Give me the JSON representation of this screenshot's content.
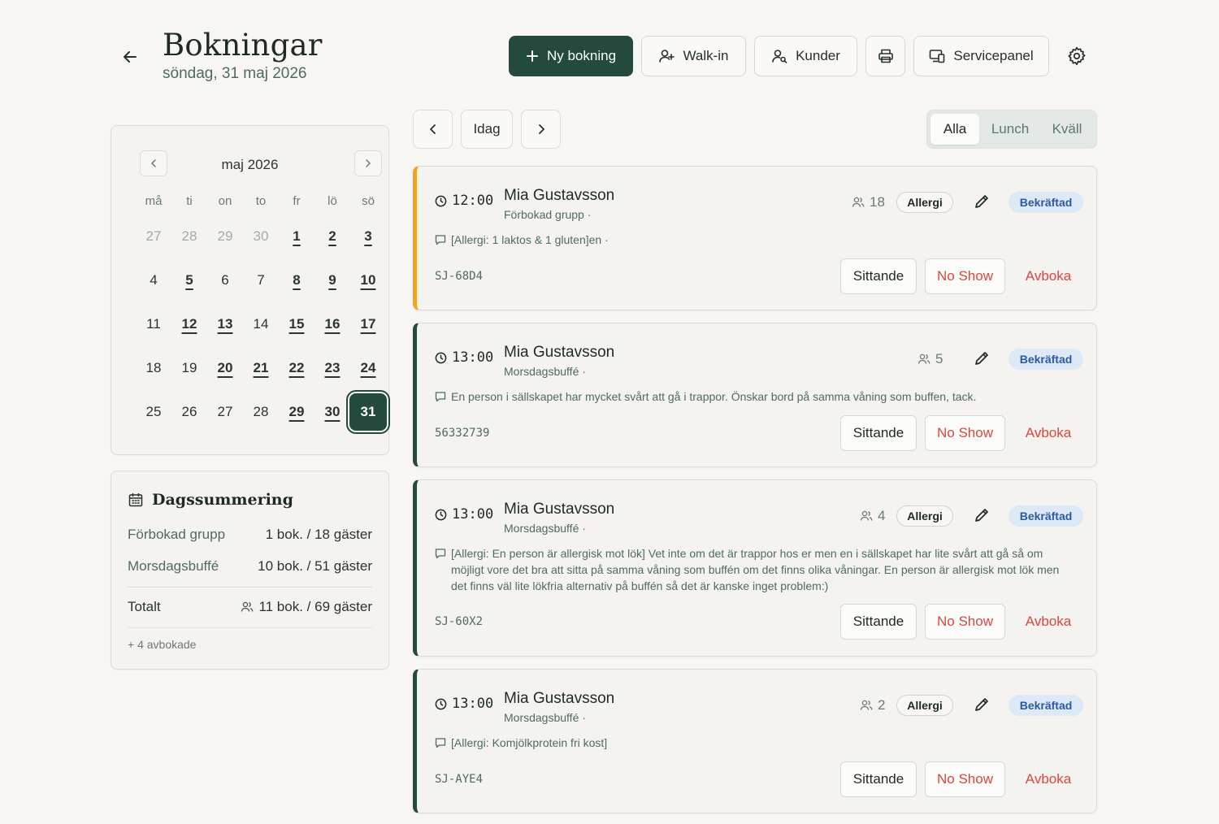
{
  "header": {
    "title": "Bokningar",
    "date": "söndag, 31 maj 2026",
    "buttons": {
      "new_booking": "Ny bokning",
      "walk_in": "Walk-in",
      "customers": "Kunder",
      "service_panel": "Servicepanel"
    }
  },
  "calendar": {
    "month": "maj 2026",
    "weekdays": [
      "må",
      "ti",
      "on",
      "to",
      "fr",
      "lö",
      "sö"
    ],
    "weeks": [
      [
        {
          "d": "27",
          "m": true
        },
        {
          "d": "28",
          "m": true
        },
        {
          "d": "29",
          "m": true
        },
        {
          "d": "30",
          "m": true
        },
        {
          "d": "1",
          "b": true
        },
        {
          "d": "2",
          "b": true
        },
        {
          "d": "3",
          "b": true
        }
      ],
      [
        {
          "d": "4"
        },
        {
          "d": "5",
          "b": true
        },
        {
          "d": "6"
        },
        {
          "d": "7"
        },
        {
          "d": "8",
          "b": true
        },
        {
          "d": "9",
          "b": true
        },
        {
          "d": "10",
          "b": true
        }
      ],
      [
        {
          "d": "11"
        },
        {
          "d": "12",
          "b": true
        },
        {
          "d": "13",
          "b": true
        },
        {
          "d": "14"
        },
        {
          "d": "15",
          "b": true
        },
        {
          "d": "16",
          "b": true
        },
        {
          "d": "17",
          "b": true
        }
      ],
      [
        {
          "d": "18"
        },
        {
          "d": "19"
        },
        {
          "d": "20",
          "b": true
        },
        {
          "d": "21",
          "b": true
        },
        {
          "d": "22",
          "b": true
        },
        {
          "d": "23",
          "b": true
        },
        {
          "d": "24",
          "b": true
        }
      ],
      [
        {
          "d": "25"
        },
        {
          "d": "26"
        },
        {
          "d": "27"
        },
        {
          "d": "28"
        },
        {
          "d": "29",
          "b": true
        },
        {
          "d": "30",
          "b": true
        },
        {
          "d": "31",
          "s": true
        }
      ]
    ]
  },
  "summary": {
    "title": "Dagssummering",
    "rows": [
      {
        "label": "Förbokad grupp",
        "value": "1 bok. / 18 gäster"
      },
      {
        "label": "Morsdagsbuffé",
        "value": "10 bok. / 51 gäster"
      }
    ],
    "total_label": "Totalt",
    "total_value": "11 bok. / 69 gäster",
    "cancelled": "+ 4 avbokade"
  },
  "date_nav": {
    "today": "Idag",
    "filters": [
      "Alla",
      "Lunch",
      "Kväll"
    ],
    "active_filter": "Alla"
  },
  "colors": {
    "primary": "#234a3c",
    "accent_orange": "#f0a422",
    "danger": "#d9473f",
    "status_bg": "#dde9f7",
    "status_text": "#2b5aa5"
  },
  "bookings": [
    {
      "time": "12:00",
      "name": "Mia Gustavsson",
      "type": "Förbokad grupp ·",
      "guests": "18",
      "allergy": "Allergi",
      "status": "Bekräftad",
      "note": "[Allergi: 1 laktos & 1 gluten]en ·",
      "code": "SJ-68D4",
      "sit": "Sittande",
      "noshow": "No Show",
      "cancel": "Avboka"
    },
    {
      "time": "13:00",
      "name": "Mia Gustavsson",
      "type": "Morsdagsbuffé ·",
      "guests": "5",
      "allergy": "",
      "status": "Bekräftad",
      "note": "En person i sällskapet har mycket svårt att gå i trappor. Önskar bord på samma våning som buffen, tack.",
      "code": "56332739",
      "sit": "Sittande",
      "noshow": "No Show",
      "cancel": "Avboka"
    },
    {
      "time": "13:00",
      "name": "Mia Gustavsson",
      "type": "Morsdagsbuffé ·",
      "guests": "4",
      "allergy": "Allergi",
      "status": "Bekräftad",
      "note": "[Allergi: En person är allergisk mot lök] Vet inte om det är trappor hos er men en i sällskapet har lite svårt att gå så om möjligt vore det bra att sitta på samma våning som buffén om det finns olika våningar. En person är allergisk mot lök men det finns väl lite lökfria alternativ på buffén så det är kanske inget problem:)",
      "code": "SJ-60X2",
      "sit": "Sittande",
      "noshow": "No Show",
      "cancel": "Avboka"
    },
    {
      "time": "13:00",
      "name": "Mia Gustavsson",
      "type": "Morsdagsbuffé ·",
      "guests": "2",
      "allergy": "Allergi",
      "status": "Bekräftad",
      "note": "[Allergi: Komjölkprotein fri kost]",
      "code": "SJ-AYE4",
      "sit": "Sittande",
      "noshow": "No Show",
      "cancel": "Avboka"
    }
  ]
}
